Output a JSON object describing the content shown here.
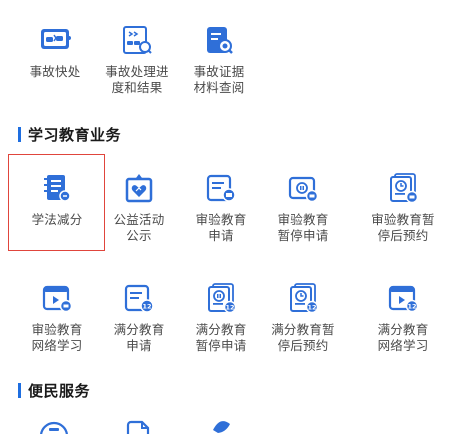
{
  "colors": {
    "brand_blue": "#2f6fd8",
    "highlight": "#e0453c"
  },
  "top_row": [
    {
      "id": "quick",
      "label": "事故快处",
      "icon": "accident-quick-icon"
    },
    {
      "id": "progress",
      "label": "事故处理进\n度和结果",
      "icon": "accident-progress-icon"
    },
    {
      "id": "evidence",
      "label": "事故证据\n材料查阅",
      "icon": "evidence-lookup-icon"
    }
  ],
  "sections": {
    "study": {
      "title": "学习教育业务"
    },
    "convenience": {
      "title": "便民服务"
    }
  },
  "study_row1": [
    {
      "id": "xuefa",
      "label": "学法减分",
      "icon": "study-deduction-icon"
    },
    {
      "id": "gongyi",
      "label": "公益活动\n公示",
      "icon": "public-welfare-icon"
    },
    {
      "id": "shenyan_apply",
      "label": "审验教育\n申请",
      "icon": "review-apply-icon"
    },
    {
      "id": "shenyan_pause",
      "label": "审验教育\n暂停申请",
      "icon": "review-pause-icon"
    },
    {
      "id": "shenyan_reserve",
      "label": "审验教育暂\n停后预约",
      "icon": "review-reserve-icon"
    }
  ],
  "study_row2": [
    {
      "id": "shenyan_online",
      "label": "审验教育\n网络学习",
      "icon": "review-online-icon"
    },
    {
      "id": "manfen_apply",
      "label": "满分教育\n申请",
      "icon": "full-score-apply-icon",
      "badge": "12"
    },
    {
      "id": "manfen_pause",
      "label": "满分教育\n暂停申请",
      "icon": "full-score-pause-icon",
      "badge": "12"
    },
    {
      "id": "manfen_reserve",
      "label": "满分教育暂\n停后预约",
      "icon": "full-score-reserve-icon",
      "badge": "12"
    },
    {
      "id": "manfen_online",
      "label": "满分教育\n网络学习",
      "icon": "full-score-online-icon",
      "badge": "12"
    }
  ]
}
